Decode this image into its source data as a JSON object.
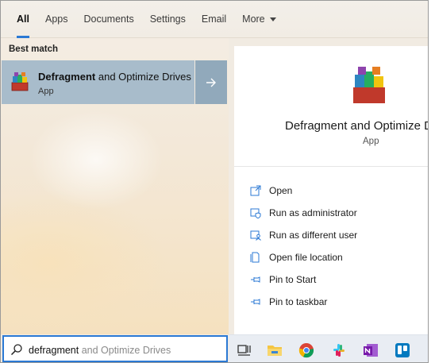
{
  "tabs": [
    {
      "label": "All",
      "active": true
    },
    {
      "label": "Apps"
    },
    {
      "label": "Documents"
    },
    {
      "label": "Settings"
    },
    {
      "label": "Email"
    },
    {
      "label": "More"
    }
  ],
  "best_match": {
    "section_label": "Best match",
    "title_bold": "Defragment",
    "title_rest": " and Optimize Drives",
    "subtitle": "App"
  },
  "preview": {
    "title": "Defragment and Optimize D",
    "type": "App",
    "actions": [
      {
        "label": "Open",
        "icon": "open-icon"
      },
      {
        "label": "Run as administrator",
        "icon": "shield-icon"
      },
      {
        "label": "Run as different user",
        "icon": "user-icon"
      },
      {
        "label": "Open file location",
        "icon": "file-location-icon"
      },
      {
        "label": "Pin to Start",
        "icon": "pin-icon"
      },
      {
        "label": "Pin to taskbar",
        "icon": "pin-icon"
      }
    ]
  },
  "search": {
    "typed": "defragment",
    "suggestion": " and Optimize Drives"
  },
  "taskbar": {
    "apps": [
      "task-view-icon",
      "file-explorer-icon",
      "chrome-icon",
      "slack-icon",
      "onenote-icon",
      "trello-icon"
    ]
  },
  "colors": {
    "accent": "#2b79d4",
    "selected_row": "#a8bccb"
  }
}
